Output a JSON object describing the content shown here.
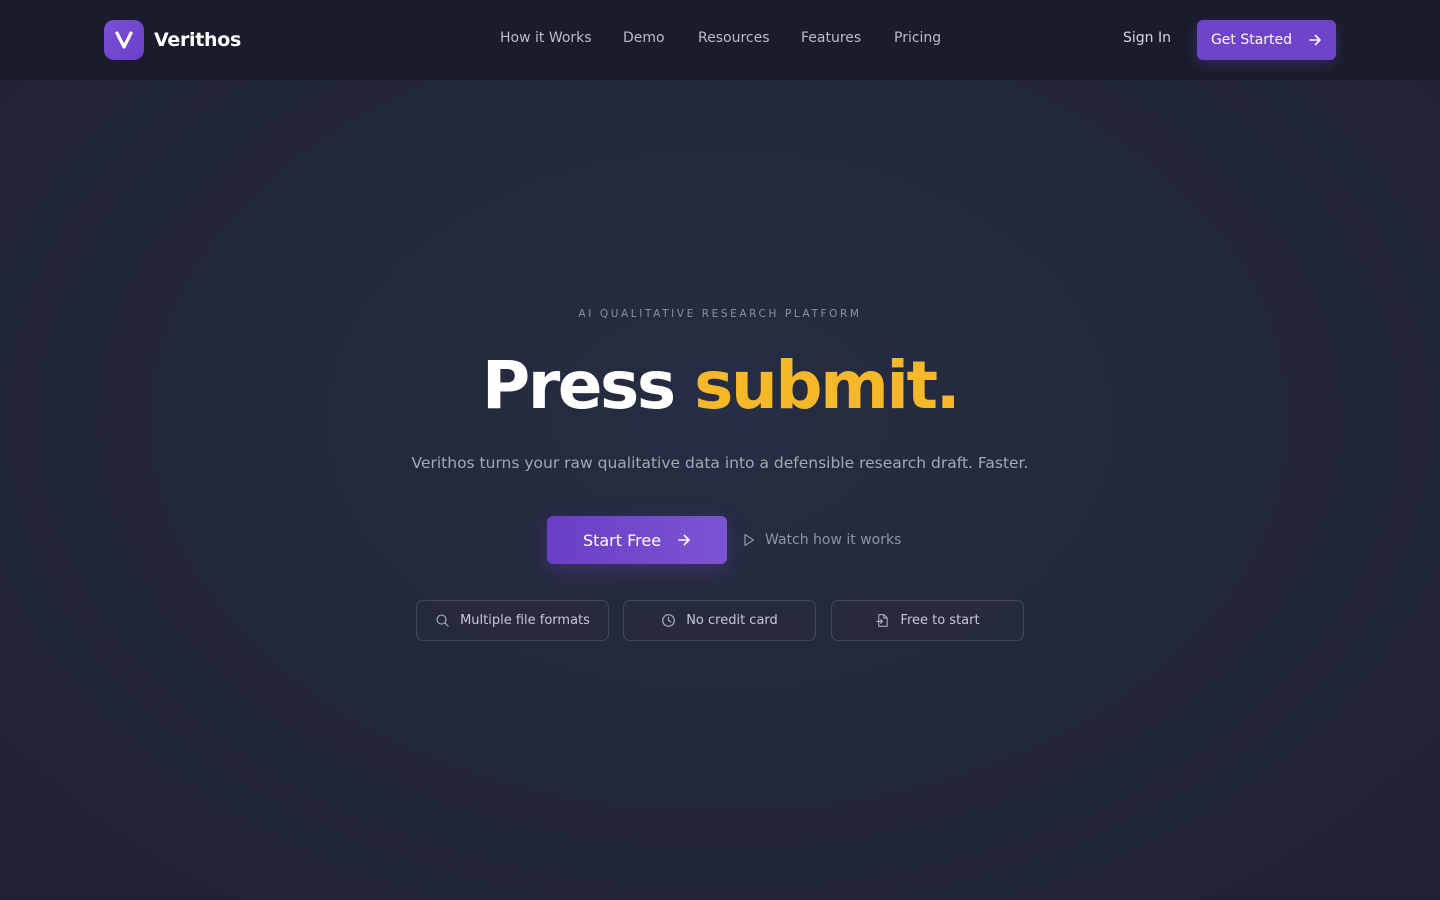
{
  "header": {
    "brand": {
      "logo_letter": "V",
      "name": "Verithos",
      "accent_color": "#6f44c9"
    },
    "nav": [
      {
        "label": "How it Works"
      },
      {
        "label": "Demo"
      },
      {
        "label": "Resources"
      },
      {
        "label": "Features"
      },
      {
        "label": "Pricing"
      }
    ],
    "sign_in_label": "Sign In",
    "cta": {
      "label": "Get Started",
      "icon": "arrow-right-icon"
    }
  },
  "hero": {
    "eyebrow": "AI QUALITATIVE RESEARCH PLATFORM",
    "headline": {
      "part1": "Press",
      "part2": "submit.",
      "highlight_color": "#f4b829"
    },
    "subheadline": "Verithos turns your raw qualitative data into a defensible research draft. Faster.",
    "primary_cta": {
      "label": "Start Free",
      "icon": "arrow-right-icon"
    },
    "secondary_cta": {
      "label": "Watch how it works",
      "icon": "play-icon"
    },
    "features": [
      {
        "label": "Multiple file formats",
        "icon": "search-icon"
      },
      {
        "label": "No credit card",
        "icon": "clock-icon"
      },
      {
        "label": "Free to start",
        "icon": "document-icon"
      }
    ]
  }
}
